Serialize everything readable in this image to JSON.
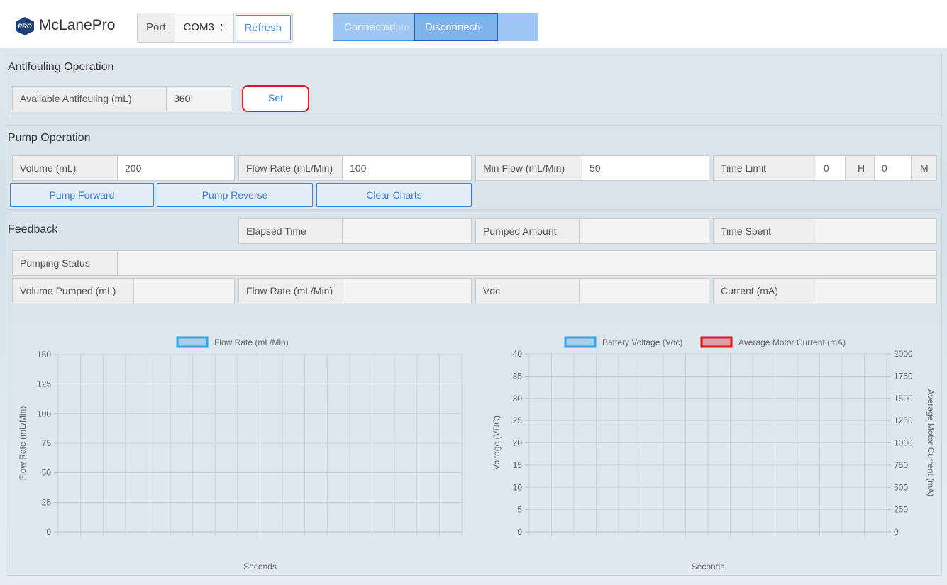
{
  "header": {
    "logo_badge": "PRO",
    "app_name": "McLanePro",
    "port_label": "Port",
    "port_value": "COM3 ≑",
    "refresh_label": "Refresh",
    "status_label": "Connected",
    "status_ghost": "ate",
    "disconnect_label": "Disconnect",
    "disconnect_ghost": "e"
  },
  "antifouling": {
    "title": "Antifouling Operation",
    "available_label": "Available Antifouling (mL)",
    "available_value": "360",
    "set_label": "Set"
  },
  "pump": {
    "title": "Pump Operation",
    "volume_label": "Volume (mL)",
    "volume_value": "200",
    "flow_rate_label": "Flow Rate (mL/Min)",
    "flow_rate_value": "100",
    "min_flow_label": "Min Flow (mL/Min)",
    "min_flow_value": "50",
    "time_limit_label": "Time Limit",
    "hours_value": "0",
    "hours_unit": "H",
    "minutes_value": "0",
    "minutes_unit": "M",
    "forward_label": "Pump Forward",
    "reverse_label": "Pump Reverse",
    "clear_label": "Clear Charts"
  },
  "feedback": {
    "title": "Feedback",
    "elapsed_label": "Elapsed Time",
    "elapsed_value": "",
    "pumped_amount_label": "Pumped Amount",
    "pumped_amount_value": "",
    "time_spent_label": "Time Spent",
    "time_spent_value": "",
    "status_label": "Pumping Status",
    "status_value": "",
    "volume_pumped_label": "Volume Pumped (mL)",
    "volume_pumped_value": "",
    "flow_rate_label": "Flow Rate (mL/Min)",
    "flow_rate_value": "",
    "vdc_label": "Vdc",
    "vdc_value": "",
    "current_label": "Current (mA)",
    "current_value": ""
  },
  "chart_data": [
    {
      "type": "line",
      "legend_placement": "top",
      "series": [
        {
          "name": "Flow Rate (mL/Min)",
          "color": "#36a2eb",
          "values": []
        }
      ],
      "xlabel": "Seconds",
      "ylabel": "Flow Rate (mL/Min)",
      "ylim": [
        0,
        150
      ],
      "yticks": [
        "0",
        "25",
        "50",
        "75",
        "100",
        "125",
        "150"
      ],
      "grid": true
    },
    {
      "type": "line",
      "legend_placement": "top",
      "series": [
        {
          "name": "Battery Voltage (Vdc)",
          "color": "#36a2eb",
          "values": []
        },
        {
          "name": "Average Motor Current (mA)",
          "color": "#e8141d",
          "values": []
        }
      ],
      "xlabel": "Seconds",
      "ylabel": "Voltage (VDC)",
      "ylabel_right": "Average Motor Current (mA)",
      "ylim": [
        0,
        40
      ],
      "ylim_right": [
        0,
        2000
      ],
      "yticks": [
        "0",
        "5",
        "10",
        "15",
        "20",
        "25",
        "30",
        "35",
        "40"
      ],
      "yticks_right": [
        "0",
        "250",
        "500",
        "750",
        "1000",
        "1250",
        "1500",
        "1750",
        "2000"
      ],
      "grid": true
    }
  ]
}
